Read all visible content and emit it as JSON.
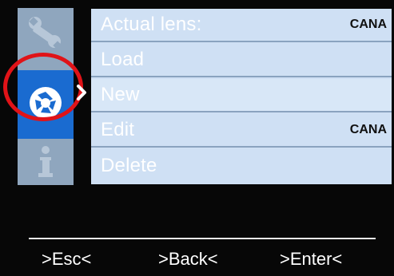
{
  "sidebar": {
    "icons": [
      "wrench-icon",
      "lens-aperture-icon",
      "info-icon"
    ],
    "selected": "lens-aperture-icon"
  },
  "menu": {
    "items": [
      {
        "label": "Actual lens:",
        "value": "CANA"
      },
      {
        "label": "Load",
        "value": ""
      },
      {
        "label": "New",
        "value": ""
      },
      {
        "label": "Edit",
        "value": "CANA"
      },
      {
        "label": "Delete",
        "value": ""
      }
    ]
  },
  "softkeys": {
    "esc": ">Esc<",
    "back": ">Back<",
    "enter": ">Enter<"
  },
  "colors": {
    "menu_bg": "#cfe0f4",
    "sidebar_bg": "#8fa6be",
    "selected_icon_bg": "#1a6bd0",
    "highlight_ring": "#e01318"
  }
}
